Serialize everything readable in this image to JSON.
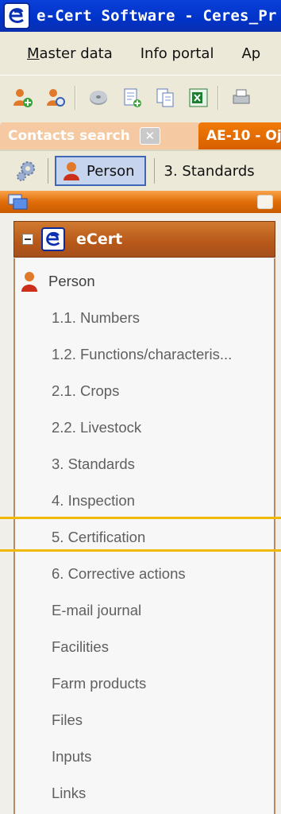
{
  "window": {
    "title": "e-Cert Software -  Ceres_Pr"
  },
  "menu": {
    "items": [
      "Master data",
      "Info portal",
      "Ap"
    ]
  },
  "toolbar": {
    "icons": [
      "add-person-icon",
      "search-person-icon",
      "disk-icon",
      "new-document-icon",
      "copy-document-icon",
      "excel-icon",
      "print-icon"
    ]
  },
  "tabs": {
    "contacts": "Contacts search",
    "active": "AE-10 - Oj"
  },
  "subbar": {
    "person": "Person",
    "standards": "3. Standards"
  },
  "tree": {
    "root": "eCert",
    "items": [
      "Person",
      "1.1. Numbers",
      "1.2. Functions/characteris...",
      "2.1. Crops",
      "2.2. Livestock",
      "3. Standards",
      "4. Inspection",
      "5. Certification",
      "6. Corrective actions",
      "E-mail journal",
      "Facilities",
      "Farm products",
      "Files",
      "Inputs",
      "Links"
    ]
  },
  "colors": {
    "accent": "#e06d08",
    "highlight": "#f0b800",
    "title_bar": "#0033c8"
  }
}
